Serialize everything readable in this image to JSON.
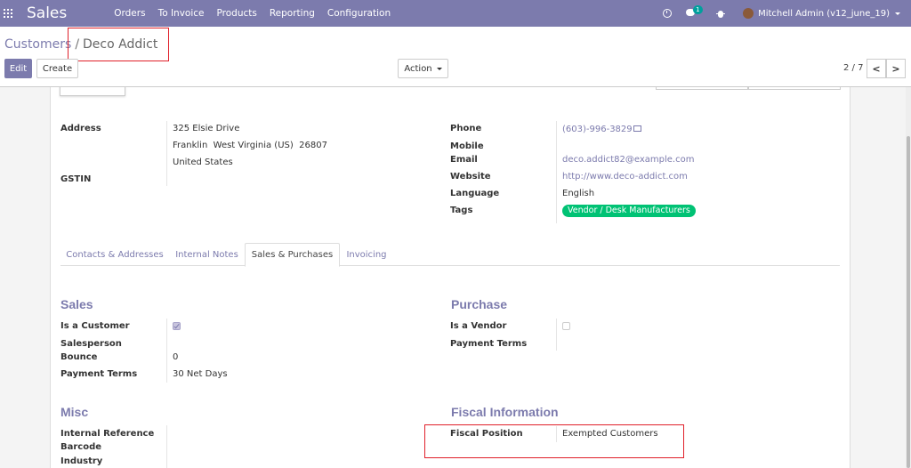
{
  "navbar": {
    "brand": "Sales",
    "menu": [
      "Orders",
      "To Invoice",
      "Products",
      "Reporting",
      "Configuration"
    ],
    "chat_count": "1",
    "user": "Mitchell Admin (v12_june_19)"
  },
  "breadcrumb": {
    "parent": "Customers",
    "separator": "/",
    "current": "Deco Addict"
  },
  "toolbar": {
    "edit": "Edit",
    "create": "Create",
    "action": "Action"
  },
  "pager": {
    "value": "2 / 7",
    "prev": "<",
    "next": ">"
  },
  "contact": {
    "address_label": "Address",
    "address_lines": [
      "325 Elsie Drive",
      "Franklin  West Virginia (US)  26807",
      "United States"
    ],
    "gstin_label": "GSTIN",
    "phone_label": "Phone",
    "phone": "(603)-996-3829",
    "mobile_label": "Mobile",
    "email_label": "Email",
    "email": "deco.addict82@example.com",
    "website_label": "Website",
    "website": "http://www.deco-addict.com",
    "language_label": "Language",
    "language": "English",
    "tags_label": "Tags",
    "tag": "Vendor / Desk Manufacturers"
  },
  "tabs": [
    {
      "label": "Contacts & Addresses",
      "active": false
    },
    {
      "label": "Internal Notes",
      "active": false
    },
    {
      "label": "Sales & Purchases",
      "active": true
    },
    {
      "label": "Invoicing",
      "active": false
    }
  ],
  "sales": {
    "title": "Sales",
    "is_customer_label": "Is a Customer",
    "is_customer": true,
    "salesperson_label": "Salesperson",
    "bounce_label": "Bounce",
    "bounce": "0",
    "payment_terms_label": "Payment Terms",
    "payment_terms": "30 Net Days"
  },
  "purchase": {
    "title": "Purchase",
    "is_vendor_label": "Is a Vendor",
    "is_vendor": false,
    "payment_terms_label": "Payment Terms"
  },
  "misc": {
    "title": "Misc",
    "internal_ref_label": "Internal Reference",
    "barcode_label": "Barcode",
    "industry_label": "Industry"
  },
  "fiscal": {
    "title": "Fiscal Information",
    "position_label": "Fiscal Position",
    "position": "Exempted Customers"
  },
  "colors": {
    "brand": "#7c7bad",
    "tag": "#00c274",
    "highlight": "#e0202a"
  }
}
